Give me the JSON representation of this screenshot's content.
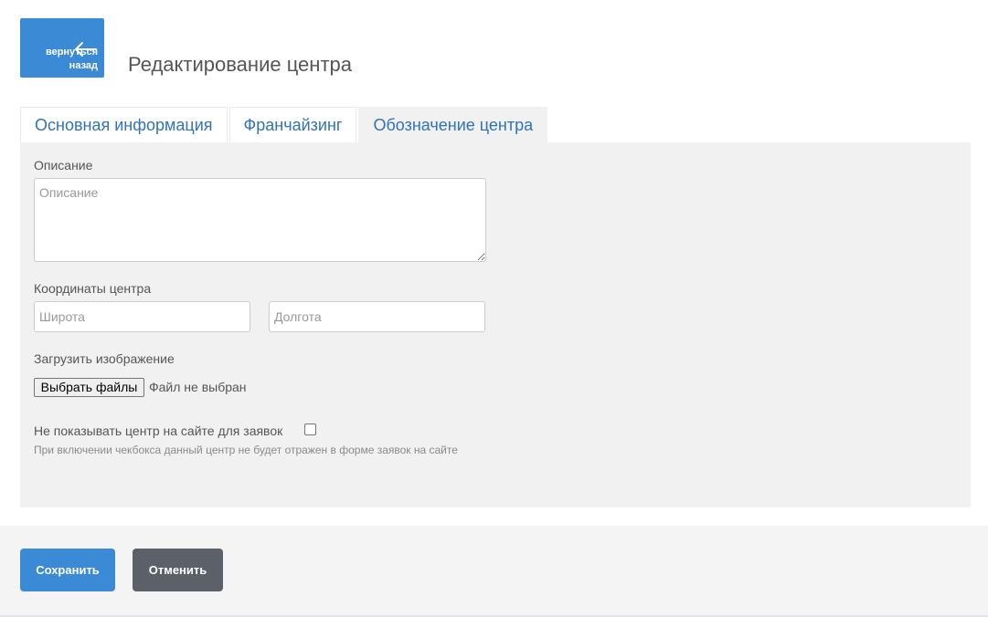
{
  "header": {
    "back_label": "вернуться\nназад",
    "title": "Редактирование центра"
  },
  "tabs": [
    {
      "label": "Основная информация",
      "active": false
    },
    {
      "label": "Франчайзинг",
      "active": false
    },
    {
      "label": "Обозначение центра",
      "active": true
    }
  ],
  "form": {
    "description": {
      "label": "Описание",
      "placeholder": "Описание",
      "value": ""
    },
    "coordinates": {
      "label": "Координаты центра",
      "lat_placeholder": "Широта",
      "lng_placeholder": "Долгота"
    },
    "image": {
      "label": "Загрузить изображение",
      "button_label": "Выбрать файлы",
      "status": "Файл не выбран"
    },
    "hide_checkbox": {
      "label": "Не показывать центр на сайте для заявок",
      "checked": false,
      "hint": "При включении чекбокса данный центр не будет отражен в форме заявок на сайте"
    }
  },
  "footer": {
    "save_label": "Сохранить",
    "cancel_label": "Отменить"
  },
  "colors": {
    "primary": "#3a8ad6",
    "cancel": "#5c6068",
    "tab_text": "#3173b9",
    "panel_bg": "#f1f1f1"
  },
  "icons": {
    "back": "arrow-left-icon"
  }
}
